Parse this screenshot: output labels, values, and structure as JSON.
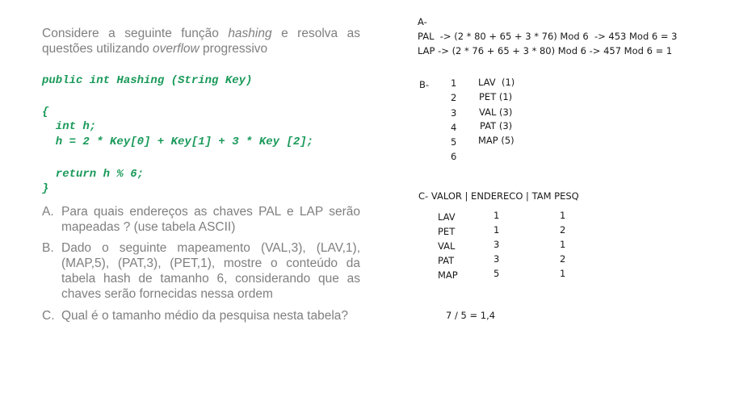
{
  "left": {
    "intro": {
      "p1": "Considere a seguinte função ",
      "em1": "hashing",
      "p2": " e resolva as questões utilizando ",
      "em2": "overflow",
      "p3": " progressivo"
    },
    "code": [
      "public int Hashing (String Key)",
      "{",
      "  int h;",
      "  h = 2 * Key[0] + Key[1] + 3 * Key [2];",
      "  return h % 6;",
      "}"
    ],
    "questions": [
      {
        "letter": "A.",
        "text": "Para quais endereços as chaves PAL e LAP serão mapeadas ? (use tabela ASCII)"
      },
      {
        "letter": "B.",
        "text": "Dado o seguinte mapeamento (VAL,3), (LAV,1), (MAP,5), (PAT,3), (PET,1), mostre o conteúdo da tabela hash de tamanho 6,  considerando que as chaves serão fornecidas nessa ordem"
      },
      {
        "letter": "C.",
        "text": "Qual é o tamanho médio da pesquisa nesta tabela?"
      }
    ]
  },
  "right": {
    "a_label": "A-",
    "a_line1": "PAL  -> (2 * 80 + 65 + 3 * 76) Mod 6  -> 453 Mod 6 = 3",
    "a_line2": "LAP -> (2 * 76 + 65 + 3 * 80) Mod 6 -> 457 Mod 6 = 1",
    "b_label": "B-",
    "b_rows": [
      {
        "n": "1",
        "v": "LAV  (1)"
      },
      {
        "n": "2",
        "v": "PET (1)"
      },
      {
        "n": "3",
        "v": "VAL (3)"
      },
      {
        "n": "4",
        "v": "PAT (3)"
      },
      {
        "n": "5",
        "v": "MAP (5)"
      },
      {
        "n": "6",
        "v": ""
      }
    ],
    "c_header": "C- VALOR | ENDERECO | TAM PESQ",
    "c_rows": [
      [
        "LAV",
        "1",
        "1"
      ],
      [
        "PET",
        "1",
        "2"
      ],
      [
        "VAL",
        "3",
        "1"
      ],
      [
        "PAT",
        "3",
        "2"
      ],
      [
        "MAP",
        "5",
        "1"
      ]
    ],
    "c_result": "7 / 5 = 1,4"
  }
}
